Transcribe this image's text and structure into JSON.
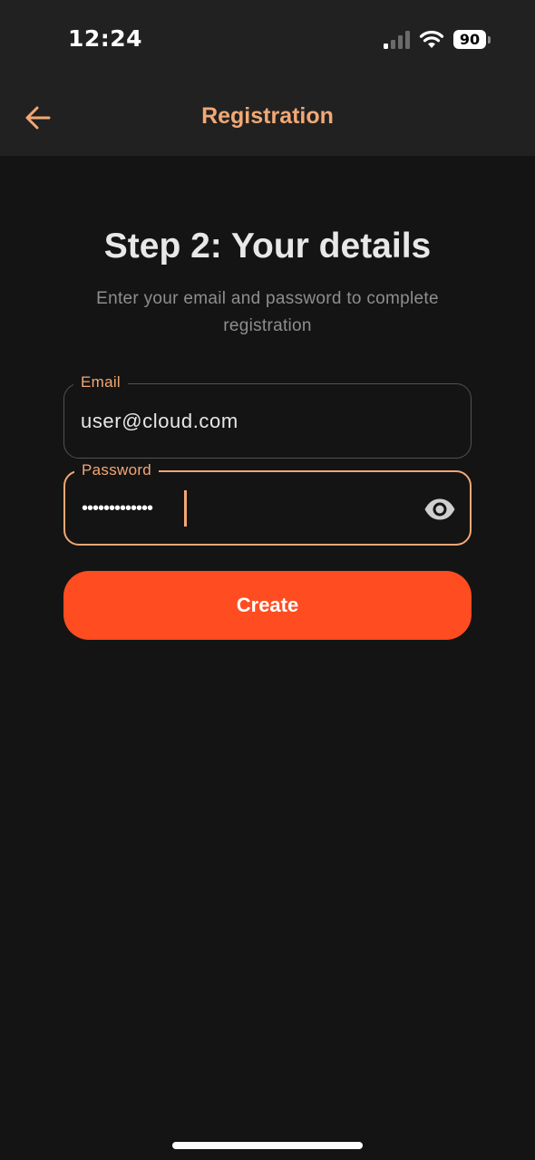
{
  "status_bar": {
    "time": "12:24",
    "battery_level": "90",
    "signal_icon": "cellular-signal-icon",
    "wifi_icon": "wifi-icon",
    "battery_icon": "battery-icon"
  },
  "app_bar": {
    "title": "Registration",
    "back_icon": "arrow-left-icon"
  },
  "form": {
    "heading": "Step 2: Your details",
    "subtitle": "Enter your email and password to complete registration",
    "email": {
      "label": "Email",
      "value": "user@cloud.com"
    },
    "password": {
      "label": "Password",
      "masked_value": "•••••••••••••",
      "visibility_icon": "eye-icon"
    },
    "submit_label": "Create"
  },
  "colors": {
    "accent": "#f2a875",
    "primary_button": "#ff4c20",
    "background": "#141414",
    "header_background": "#212121"
  }
}
